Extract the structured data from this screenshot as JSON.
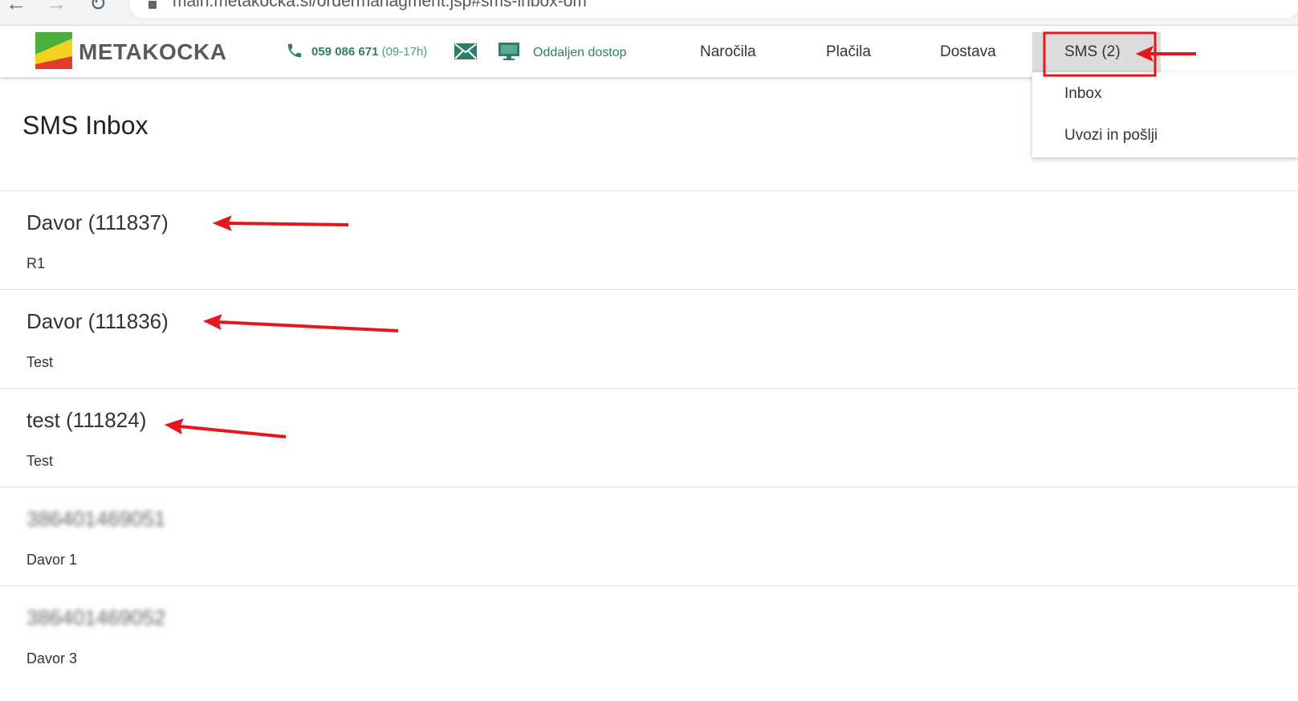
{
  "browser": {
    "url": "main.metakocka.si/ordermanagment.jsp#sms-inbox-om",
    "back_icon": "arrow-left-icon",
    "forward_icon": "arrow-right-icon",
    "reload_icon": "reload-icon",
    "lock_icon": "lock-icon"
  },
  "header": {
    "logo_text": "METAKOCKA",
    "phone": "059 086 671",
    "phone_hours": "(09-17h)",
    "remote_access": "Oddaljen dostop",
    "accent_color": "#2e7d6b",
    "nav": [
      {
        "label": "Naročila"
      },
      {
        "label": "Plačila"
      },
      {
        "label": "Dostava"
      },
      {
        "label": "SMS (2)"
      }
    ]
  },
  "dropdown": {
    "items": [
      {
        "label": "Inbox"
      },
      {
        "label": "Uvozi in pošlji"
      }
    ]
  },
  "page": {
    "title": "SMS Inbox"
  },
  "messages": [
    {
      "sender": "Davor (111837)",
      "body": "R1"
    },
    {
      "sender": "Davor (111836)",
      "body": "Test"
    },
    {
      "sender": "test (111824)",
      "body": "Test"
    },
    {
      "sender": "386401469051",
      "body": "Davor 1",
      "blurred": true
    },
    {
      "sender": "386401469052",
      "body": "Davor 3",
      "blurred": true
    }
  ],
  "annotations": {
    "color": "#e8161c"
  }
}
